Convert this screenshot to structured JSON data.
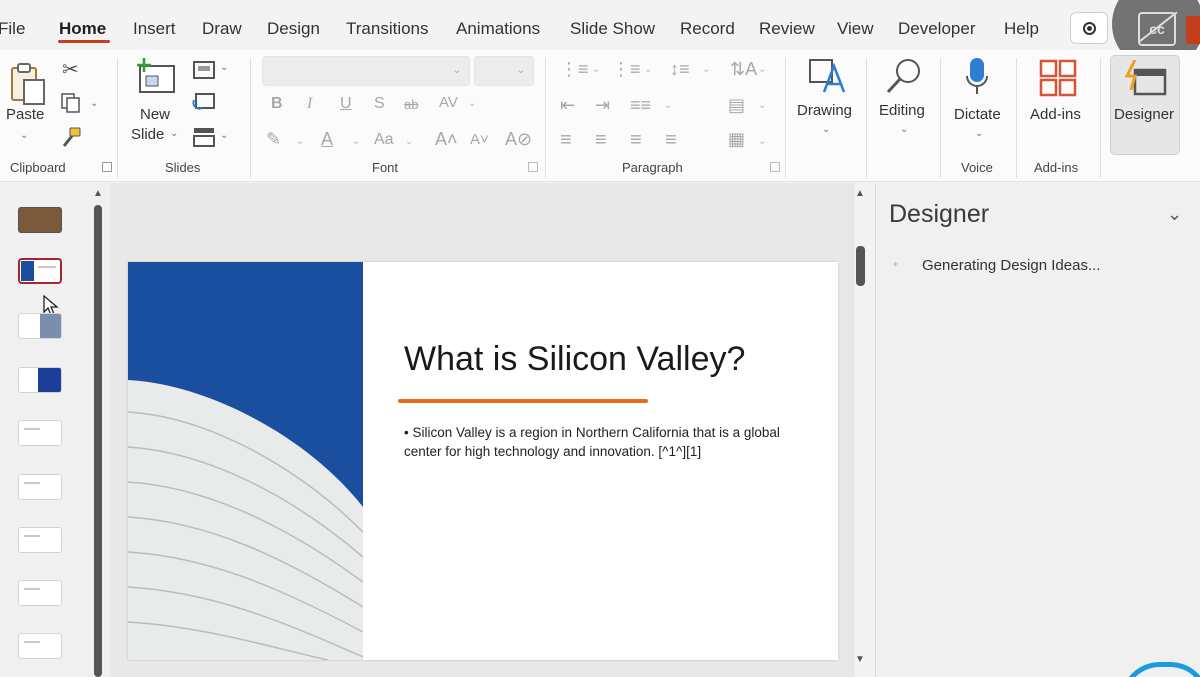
{
  "menu": {
    "tabs": [
      "File",
      "Home",
      "Insert",
      "Draw",
      "Design",
      "Transitions",
      "Animations",
      "Slide Show",
      "Record",
      "Review",
      "View",
      "Developer",
      "Help"
    ],
    "active_tab": "Home"
  },
  "ribbon": {
    "clipboard": {
      "paste_label": "Paste",
      "group_label": "Clipboard"
    },
    "slides": {
      "new_slide_line1": "New",
      "new_slide_line2": "Slide",
      "group_label": "Slides"
    },
    "font": {
      "group_label": "Font",
      "bold": "B",
      "italic": "I",
      "underline": "U",
      "shadow": "S",
      "strike": "ab",
      "spacing": "AV",
      "font_color": "A",
      "case": "Aa",
      "grow": "A˄",
      "shrink": "A˅"
    },
    "paragraph": {
      "group_label": "Paragraph"
    },
    "drawing_label": "Drawing",
    "editing_label": "Editing",
    "voice": {
      "dictate_label": "Dictate",
      "group_label": "Voice"
    },
    "addins": {
      "label": "Add-ins",
      "group_label": "Add-ins"
    },
    "designer_label": "Designer"
  },
  "slide": {
    "title": "What is Silicon Valley?",
    "bullet": "Silicon Valley is a region in Northern California that is a global center for high technology and innovation. [^1^][1]"
  },
  "designer_pane": {
    "title": "Designer",
    "status": "Generating Design Ideas..."
  },
  "colors": {
    "accent": "#c43e1c",
    "title_rule": "#e36c1f",
    "selected_thumb": "#a4262c",
    "sky_blue": "#1a4fa0"
  }
}
